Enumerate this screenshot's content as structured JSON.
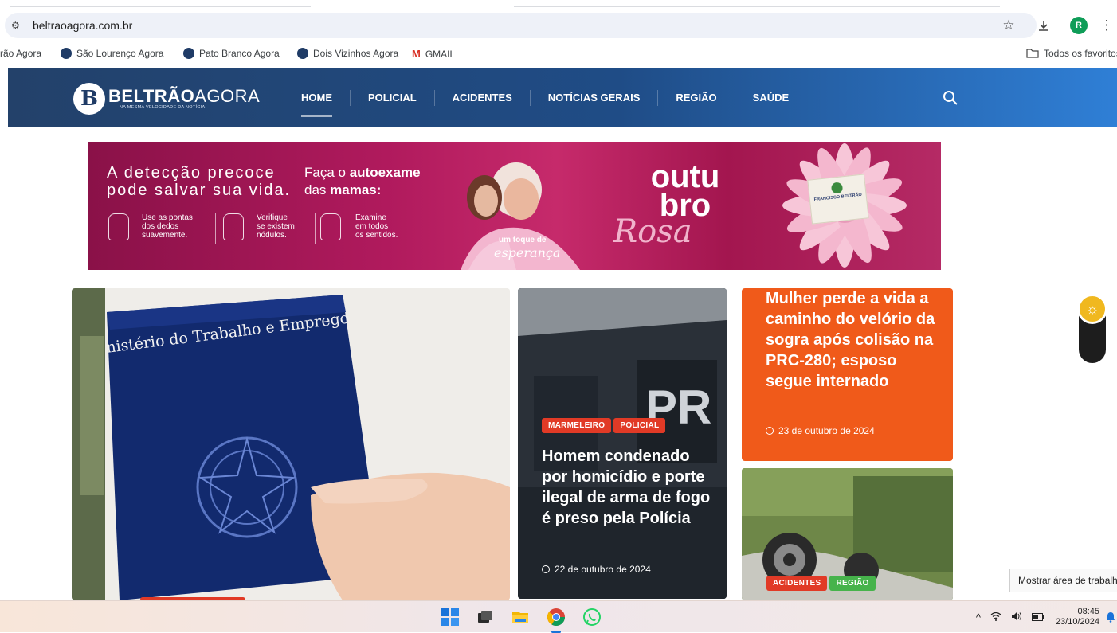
{
  "browser": {
    "url": "beltraoagora.com.br",
    "bookmarks": [
      {
        "label": "rão Agora"
      },
      {
        "label": "São Lourenço Agora"
      },
      {
        "label": "Pato Branco Agora"
      },
      {
        "label": "Dois Vizinhos Agora"
      },
      {
        "label": "GMAIL"
      }
    ],
    "all_bookmarks": "Todos os favoritos",
    "profile_initial": "R"
  },
  "site": {
    "logo_bold": "BELTRÃO",
    "logo_light": "AGORA",
    "logo_tagline": "NA MESMA VELOCIDADE DA NOTÍCIA",
    "nav": [
      "HOME",
      "POLICIAL",
      "ACIDENTES",
      "NOTÍCIAS GERAIS",
      "REGIÃO",
      "SAÚDE"
    ],
    "active_nav": "HOME"
  },
  "banner": {
    "headline_line1": "A detecção precoce",
    "headline_line2": "pode salvar sua vida.",
    "cta_pre": "Faça o ",
    "cta_bold1": "autoexame",
    "cta_mid": "das ",
    "cta_bold2": "mamas:",
    "tips": [
      {
        "l1": "Use as pontas",
        "l2": "dos dedos",
        "l3": "suavemente."
      },
      {
        "l1": "Verifique",
        "l2": "se existem",
        "l3": "nódulos."
      },
      {
        "l1": "Examine",
        "l2": "em todos",
        "l3": "os sentidos."
      }
    ],
    "slogan_small": "um toque de",
    "slogan_script": "esperança",
    "campaign_top": "outu",
    "campaign_mid": "bro",
    "campaign_script": "Rosa",
    "stamp_name": "FRANCISCO BELTRÃO"
  },
  "news": {
    "main": {
      "image_text": "nistério do Trabalho e Emprego"
    },
    "police": {
      "tags": [
        "MARMELEIRO",
        "POLICIAL"
      ],
      "title": "Homem condenado por homicídio e porte ilegal de arma de fogo é preso pela Polícia",
      "date": "22 de outubro de 2024"
    },
    "orange": {
      "title": "Mulher perde a vida a caminho do velório da sogra após colisão na PRC-280; esposo segue internado",
      "date": "23 de outubro de 2024"
    },
    "crash": {
      "tags": [
        "ACIDENTES",
        "REGIÃO"
      ]
    }
  },
  "tooltip": "Mostrar área de trabalho",
  "taskbar": {
    "time": "08:45",
    "date": "23/10/2024"
  },
  "colors": {
    "header_start": "#23416a",
    "header_end": "#2f7fd6",
    "banner": "#b01a5d",
    "orange_card": "#f05a1a",
    "tag_red": "#e13a26",
    "tag_green": "#46b34b"
  }
}
